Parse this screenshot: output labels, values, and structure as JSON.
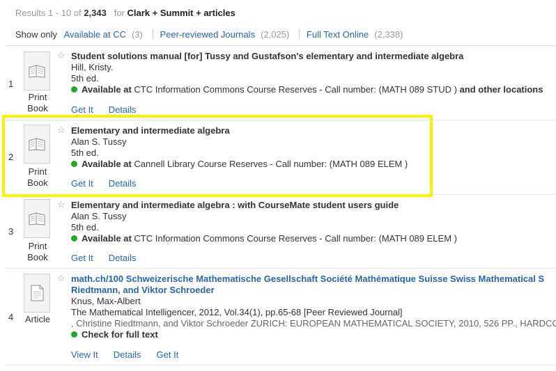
{
  "results_header": {
    "range": "Results 1 - 10 of",
    "total": "2,343",
    "for_word": "for",
    "query": "Clark + Summit + articles"
  },
  "filters": {
    "show_only_label": "Show only",
    "items": [
      {
        "label": "Available at CC",
        "count": "(3)"
      },
      {
        "label": "Peer-reviewed Journals",
        "count": "(2,025)"
      },
      {
        "label": "Full Text Online",
        "count": "(2,338)"
      }
    ]
  },
  "icons": {
    "star": "star-icon",
    "print_book": "print-book-icon",
    "article": "article-icon"
  },
  "colors": {
    "link": "#2a63a8",
    "available_dot": "#28a428",
    "highlight": "#f5f500"
  },
  "records": [
    {
      "number": "1",
      "type_line1": "Print",
      "type_line2": "Book",
      "title": "Student solutions manual [for] Tussy and Gustafson's elementary and intermediate algebra",
      "author": "Hill, Kristy.",
      "edition": "5th ed.",
      "avail_bold": "Available at",
      "avail_text": "CTC Information Commons Course Reserves - Call number: (MATH 089 STUD )",
      "avail_extra": "and other locations",
      "action1": "Get It",
      "action2": "Details"
    },
    {
      "number": "2",
      "type_line1": "Print",
      "type_line2": "Book",
      "title": "Elementary and intermediate algebra",
      "author": "Alan S. Tussy",
      "edition": "5th ed.",
      "avail_bold": "Available at",
      "avail_text": "Cannell Library Course Reserves - Call number: (MATH 089 ELEM )",
      "action1": "Get It",
      "action2": "Details"
    },
    {
      "number": "3",
      "type_line1": "Print",
      "type_line2": "Book",
      "title": "Elementary and intermediate algebra : with CourseMate student users guide",
      "author": "Alan S. Tussy",
      "edition": "5th ed.",
      "avail_bold": "Available at",
      "avail_text": "CTC Information Commons Course Reserves - Call number: (MATH 089 ELEM )",
      "action1": "Get It",
      "action2": "Details"
    },
    {
      "number": "4",
      "type_line1": "Article",
      "title_line1": "math.ch/100 Schweizerische Mathematische Gesellschaft Société Mathématique Suisse Swiss Mathematical S",
      "title_line2": "Riedtmann, and Viktor Schroeder",
      "author": "Knus, Max-Albert",
      "source": "The Mathematical Intelligencer, 2012, Vol.34(1), pp.65-68 [Peer Reviewed Journal]",
      "snippet": ", Christine Riedtmann, and Viktor Schroeder ZURICH: EUROPEAN MATHEMATICAL SOCIETY, 2010, 526 PP., HARDCO",
      "avail_bold": "Check for full text",
      "action1": "View It",
      "action2": "Details",
      "action3": "Get It"
    }
  ]
}
